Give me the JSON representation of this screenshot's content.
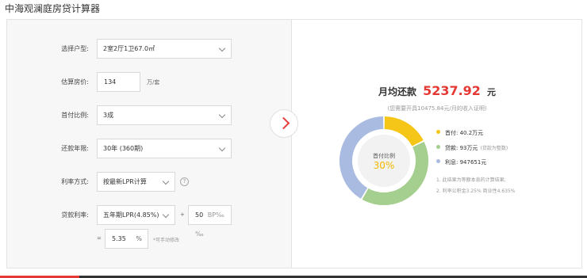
{
  "page_title": "中海观澜庭房贷计算器",
  "form": {
    "house_type": {
      "label": "选择户型:",
      "value": "2室2厅1卫67.0㎡"
    },
    "price": {
      "label": "估算房价:",
      "value": "134",
      "unit": "万/套"
    },
    "down_payment": {
      "label": "首付比例:",
      "value": "3成"
    },
    "term": {
      "label": "还款年限:",
      "value": "30年 (360期)"
    },
    "rate_mode": {
      "label": "利率方式:",
      "value": "按最新LPR计算",
      "help": "?"
    },
    "loan_rate": {
      "label": "贷款利率:",
      "value": "五年期LPR(4.85%)",
      "plus": "+",
      "bp_value": "50",
      "bp_unit": "BP‰‰"
    },
    "result_rate": {
      "eq": "=",
      "value": "5.35",
      "unit": "%",
      "note": "*可手动修改"
    }
  },
  "result": {
    "monthly_label": "月均还款",
    "monthly_amount": "5237.92",
    "monthly_unit": "元",
    "income_note": "(您需要开具10475.84元/月的收入证明)",
    "center_label": "首付比例",
    "center_value": "30%",
    "legend": [
      {
        "label": "首付:",
        "value": "40.2万元",
        "hint": "",
        "color": "#f5c518"
      },
      {
        "label": "贷款:",
        "value": "93万元",
        "hint": "(贷款为整数)",
        "color": "#a5cf8e"
      },
      {
        "label": "利息:",
        "value": "947651元",
        "hint": "",
        "color": "#a9bbe0"
      }
    ],
    "notes": [
      "1. 此结果为等额本息的计算结果;",
      "2. 利率公积金3.25% 商业性4.635%"
    ]
  },
  "chart_data": {
    "type": "pie",
    "categories": [
      "首付",
      "贷款",
      "利息"
    ],
    "values": [
      40.2,
      93,
      94.7651
    ],
    "colors": [
      "#f5c518",
      "#a5cf8e",
      "#a9bbe0"
    ]
  }
}
